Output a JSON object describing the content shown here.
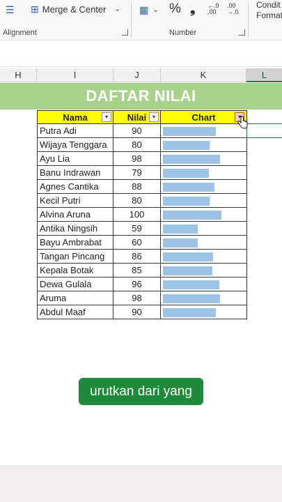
{
  "ribbon": {
    "merge_label": "Merge & Center",
    "percent_symbol": "%",
    "comma_symbol": "❟",
    "inc_decimal": "←.0 .00",
    "dec_decimal": ".00 →.0",
    "conditional_label_1": "Condit",
    "conditional_label_2": "Format",
    "alignment_label": "Alignment",
    "number_label": "Number"
  },
  "columns": [
    "H",
    "I",
    "J",
    "K",
    "L"
  ],
  "sheet": {
    "title": "DAFTAR NILAI",
    "headers": {
      "nama": "Nama",
      "nilai": "Nilai",
      "chart": "Chart"
    },
    "rows": [
      {
        "nama": "Putra Adi",
        "nilai": "90",
        "value": 90
      },
      {
        "nama": "Wijaya Tenggara",
        "nilai": "80",
        "value": 80
      },
      {
        "nama": "Ayu Lia",
        "nilai": "98",
        "value": 98
      },
      {
        "nama": "Banu Indrawan",
        "nilai": "79",
        "value": 79
      },
      {
        "nama": "Agnes Cantika",
        "nilai": "88",
        "value": 88
      },
      {
        "nama": "Kecil Putri",
        "nilai": "80",
        "value": 80
      },
      {
        "nama": "Alvina Aruna",
        "nilai": "100",
        "value": 100
      },
      {
        "nama": "Antika Ningsih",
        "nilai": "59",
        "value": 59
      },
      {
        "nama": "Bayu Ambrabat",
        "nilai": "60",
        "value": 60
      },
      {
        "nama": "Tangan Pincang",
        "nilai": "86",
        "value": 86
      },
      {
        "nama": "Kepala Botak",
        "nilai": "85",
        "value": 85
      },
      {
        "nama": "Dewa Gulala",
        "nilai": "96",
        "value": 96
      },
      {
        "nama": "Aruma",
        "nilai": "98",
        "value": 98
      },
      {
        "nama": "Abdul Maaf",
        "nilai": "90",
        "value": 90
      }
    ],
    "data_bar_max": 100
  },
  "caption": "urutkan dari yang",
  "colors": {
    "title_band": "#a9d18e",
    "header_fill": "#ffff00",
    "data_bar": "#9dc3e6",
    "caption_bg": "#1e8a3a"
  }
}
